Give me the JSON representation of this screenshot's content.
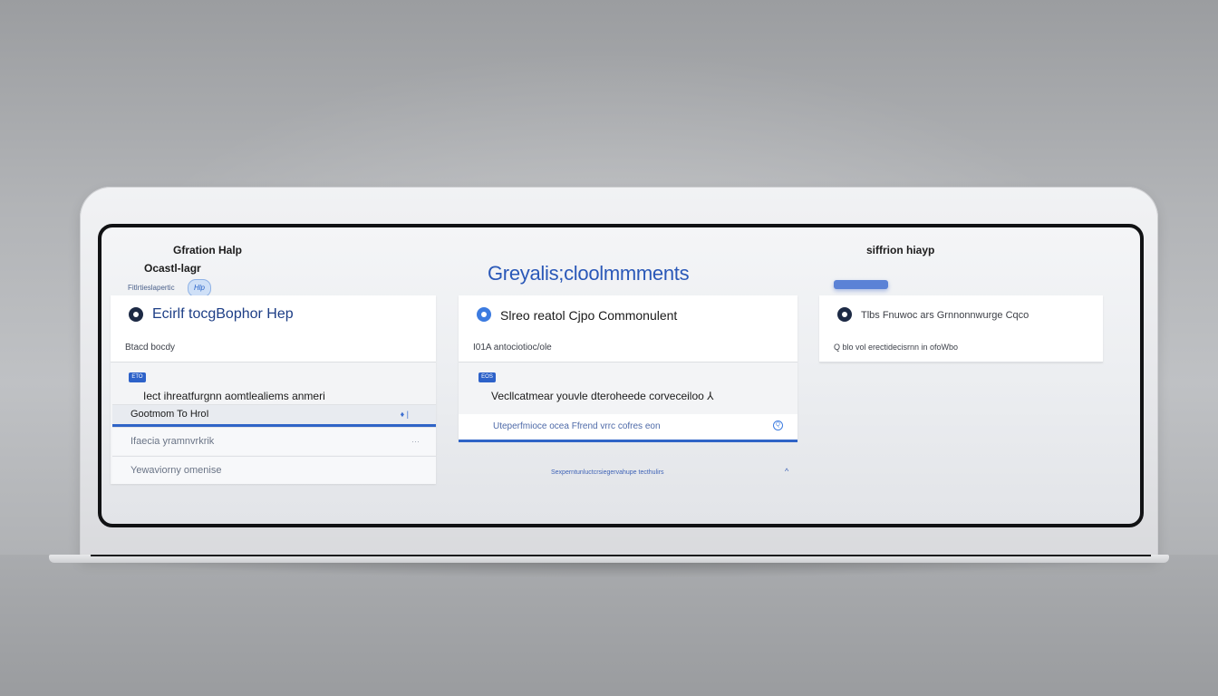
{
  "screen": {
    "left_header": {
      "title": "Gfration Halp",
      "subtitle": "Ocastl-lagr",
      "hint": "Fitlrtieslapertic",
      "help_badge": "Hlp"
    },
    "main_heading": "Greyalis;cloolmmments",
    "right_header": {
      "title": "siffrion hiayp"
    }
  },
  "panels": [
    {
      "title": "Ecirlf tocgBophor Hep",
      "subheader": "Btacd bocdy",
      "tag": "ETO",
      "prompt": "Iect ihreatfurgnn aomtlealiems anmeri",
      "active_row": {
        "label": "Gootmom To HroI",
        "end": "♦ |"
      },
      "rows": [
        {
          "label": "Ifaecia yramnvrkrik",
          "end": "···"
        },
        {
          "label": "Yewaviorny omenise",
          "end": ""
        }
      ]
    },
    {
      "title": "Slreo reatol Cjpo Commonulent",
      "subheader": "I01A antociotioc/ole",
      "tag": "EOS",
      "prompt": "Vecllcatmear youvle dteroheede corveceiloo ⅄",
      "input_placeholder": "Uteperfmioce ocea Ffrend vrrc cofres eon",
      "input_icon": "Q",
      "footnote": "Sexperntunluctcrsiegervahupe tecthulirs",
      "footnote_icon": "^"
    },
    {
      "title": "Tlbs Fnuwoc ars Grnnonnwurge Cqco",
      "subheader": "Q blo vol erectidecisrnn in ofoWbo"
    }
  ]
}
